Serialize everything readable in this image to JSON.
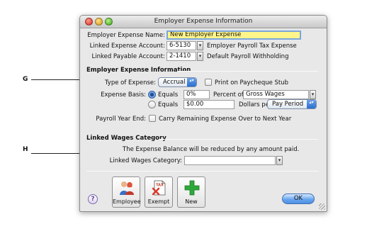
{
  "callouts": {
    "g": "G",
    "h": "H"
  },
  "window": {
    "title": "Employer Expense Information"
  },
  "form": {
    "name_label": "Employer Expense Name:",
    "name_value": "New Employer Expense",
    "expense_acct_label": "Linked Expense Account:",
    "expense_acct_value": "6-5130",
    "expense_acct_name": "Employer Payroll Tax Expense",
    "payable_acct_label": "Linked Payable Account:",
    "payable_acct_value": "2-1410",
    "payable_acct_name": "Default Payroll Withholding"
  },
  "expense_info": {
    "section_title": "Employer Expense Information",
    "type_label": "Type of Expense:",
    "type_value": "Accrual",
    "print_label": "Print on Paycheque Stub",
    "print_checked": false,
    "basis_label": "Expense Basis:",
    "equals_label_1": "Equals",
    "percent_value": "0%",
    "percent_of_label": "Percent of",
    "percent_of_value": "Gross Wages",
    "equals_label_2": "Equals",
    "dollars_value": "$0.00",
    "dollars_per_label": "Dollars per",
    "dollars_per_value": "Pay Period",
    "selected_basis": "percent",
    "year_end_label": "Payroll Year End:",
    "carry_label": "Carry Remaining Expense Over to Next Year",
    "carry_checked": false
  },
  "wages": {
    "section_title": "Linked Wages Category",
    "note": "The Expense Balance will be reduced by any amount paid.",
    "category_label": "Linked Wages Category:",
    "category_value": ""
  },
  "buttons": {
    "help": "?",
    "employee": "Employee",
    "exempt": "Exempt",
    "exempt_icon_text": "TAX",
    "new": "New",
    "ok": "OK",
    "lookup_glyph": "▾",
    "popup_glyph": "▴▾"
  },
  "colors": {
    "name_field_bg": "#fff58a",
    "accent_blue": "#4d8fe3",
    "new_plus": "#2ea83a",
    "exempt_x": "#d83a2a"
  }
}
